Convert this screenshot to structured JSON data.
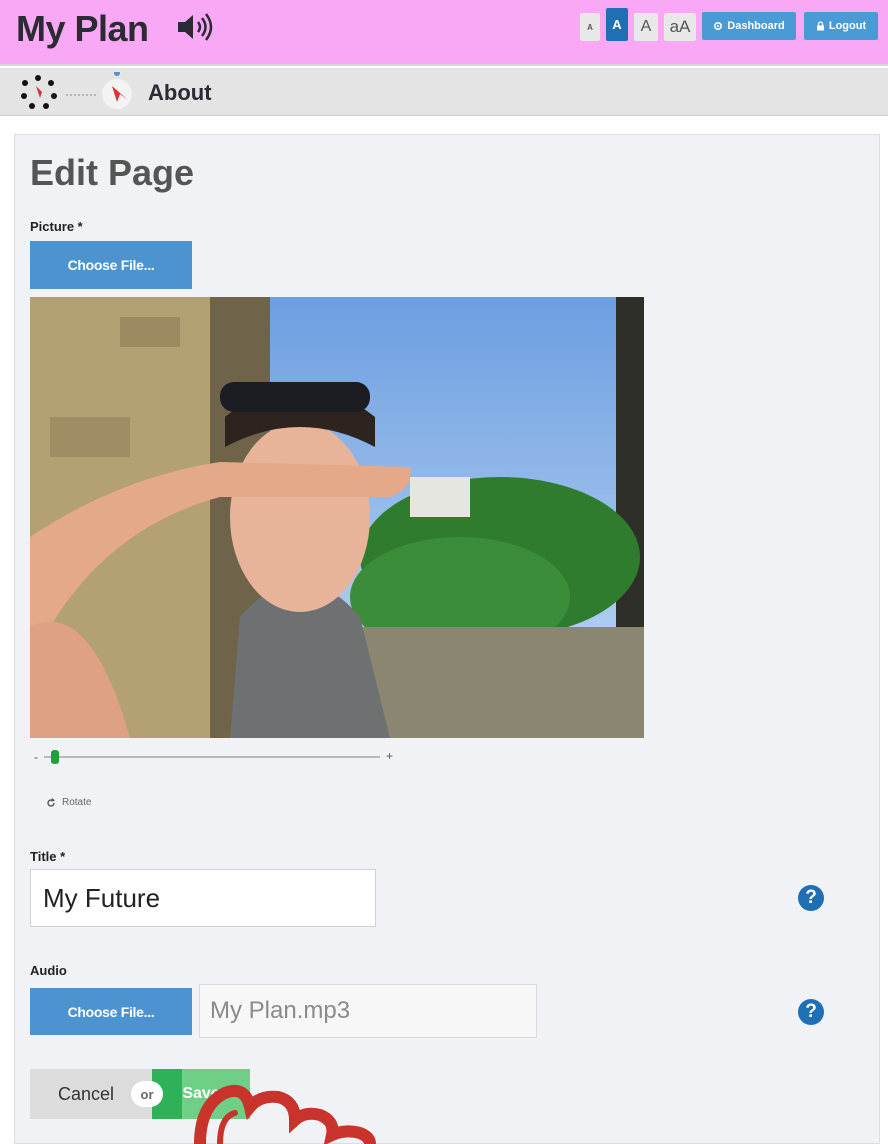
{
  "header": {
    "app_title": "My Plan",
    "font_sizes": [
      "A",
      "A",
      "A",
      "aA"
    ],
    "dashboard_label": "Dashboard",
    "logout_label": "Logout",
    "background_color": "#f9a8f5"
  },
  "breadcrumb": {
    "current": "About"
  },
  "form": {
    "page_title": "Edit Page",
    "picture_label": "Picture *",
    "picture_button": "Choose File...",
    "zoom_minus": "-",
    "zoom_plus": "+",
    "zoom_level": 0.02,
    "rotate_label": "Rotate",
    "title_label": "Title *",
    "title_value": "My Future",
    "audio_label": "Audio",
    "audio_button": "Choose File...",
    "audio_file": "My Plan.mp3",
    "help_glyph": "?",
    "cancel_label": "Cancel",
    "or_label": "or",
    "save_label": "Save"
  },
  "icons": {
    "speaker": "speaker-icon",
    "gear": "gear-icon",
    "lock": "lock-icon",
    "rotate": "rotate-icon",
    "help": "help-icon",
    "hand": "hand-pointer-icon"
  },
  "colors": {
    "primary": "#4c93cf",
    "active": "#1f6fb5",
    "save": "#2fb257",
    "hand": "#c8342b"
  }
}
